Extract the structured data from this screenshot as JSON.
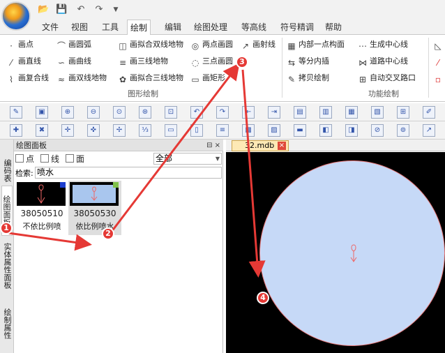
{
  "quick_access": {
    "open_icon": "folder-open-icon",
    "save_icon": "save-icon",
    "undo_icon": "undo-icon",
    "redo_icon": "redo-icon"
  },
  "menu": [
    "文件",
    "视图",
    "工具",
    "绘制",
    "编辑",
    "绘图处理",
    "等高线",
    "符号精调",
    "帮助"
  ],
  "menu_active": "绘制",
  "ribbon": {
    "draw_col1": [
      "画点",
      "画直线",
      "画复合线"
    ],
    "draw_col2": [
      "画圆弧",
      "画曲线",
      "画双线地物"
    ],
    "draw_col3": [
      "画拟合双线地物",
      "画三线地物",
      "画拟合三线地物"
    ],
    "draw_col4": [
      "两点画圆",
      "三点画圆",
      "画矩形"
    ],
    "draw_col5": [
      "画射线"
    ],
    "draw_group": "图形绘制",
    "func_col1": [
      "内部一点构面",
      "等分内插",
      "拷贝绘制"
    ],
    "func_col2": [
      "生成中心线",
      "道路中心线",
      "自动交叉路口"
    ],
    "func_group": "功能绘制"
  },
  "left_tabs": [
    "编码表",
    "绘图面板",
    "实体属性面板",
    "绘制属性"
  ],
  "panel": {
    "title": "绘图面板",
    "filters": [
      "点",
      "线",
      "面"
    ],
    "dropdown_value": "全部",
    "search_label": "检索:",
    "search_value": "喷水",
    "items": [
      {
        "code": "38050510",
        "name": "不依比例喷"
      },
      {
        "code": "38050530",
        "name": "依比例喷水"
      }
    ]
  },
  "document_tab": "32.mdb",
  "annotations": [
    "1",
    "2",
    "3",
    "4"
  ],
  "colors": {
    "accent": "#e53935",
    "circle_fill": "#c6d9f7",
    "circle_stroke": "#e87878"
  }
}
